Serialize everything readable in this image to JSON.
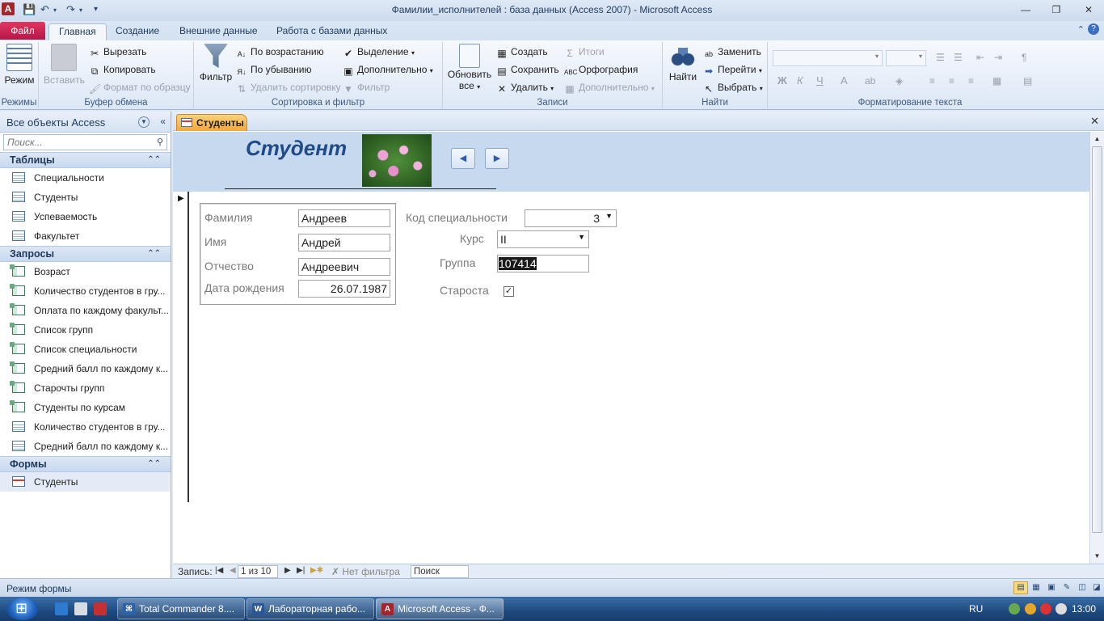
{
  "window": {
    "title": "Фамилии_исполнителей : база данных (Access 2007)  -  Microsoft Access",
    "app_icon": "A"
  },
  "ribbon_tabs": [
    {
      "label": "Файл"
    },
    {
      "label": "Главная"
    },
    {
      "label": "Создание"
    },
    {
      "label": "Внешние данные"
    },
    {
      "label": "Работа с базами данных"
    }
  ],
  "ribbon": {
    "views": {
      "label": "Режим",
      "group": "Режимы"
    },
    "clipboard": {
      "paste": "Вставить",
      "cut": "Вырезать",
      "copy": "Копировать",
      "format_painter": "Формат по образцу",
      "group": "Буфер обмена"
    },
    "sort_filter": {
      "filter": "Фильтр",
      "ascending": "По возрастанию",
      "descending": "По убыванию",
      "remove_sort": "Удалить сортировку",
      "selection": "Выделение",
      "advanced": "Дополнительно",
      "toggle_filter": "Фильтр",
      "group": "Сортировка и фильтр"
    },
    "records": {
      "refresh": "Обновить",
      "refresh2": "все",
      "new": "Создать",
      "save": "Сохранить",
      "delete": "Удалить",
      "totals": "Итоги",
      "spelling": "Орфография",
      "more": "Дополнительно",
      "group": "Записи"
    },
    "find": {
      "find": "Найти",
      "replace": "Заменить",
      "goto": "Перейти",
      "select": "Выбрать",
      "group": "Найти"
    },
    "text_format": {
      "bold": "Ж",
      "italic": "К",
      "underline": "Ч",
      "group": "Форматирование текста"
    }
  },
  "nav_pane": {
    "header": "Все объекты Access",
    "search_placeholder": "Поиск...",
    "groups": [
      {
        "title": "Таблицы",
        "items": [
          "Специальности",
          "Студенты",
          "Успеваемость",
          "Факультет"
        ]
      },
      {
        "title": "Запросы",
        "items": [
          "Возраст",
          "Количество студентов в гру...",
          "Оплата по каждому факульт...",
          "Список групп",
          "Список специальности",
          "Средний балл по каждому к...",
          "Старочты групп",
          "Студенты по курсам",
          "Количество студентов в гру...",
          "Средний балл по каждому к..."
        ]
      },
      {
        "title": "Формы",
        "items": [
          "Студенты"
        ]
      }
    ]
  },
  "document_tab": {
    "label": "Студенты"
  },
  "form": {
    "title": "Студент",
    "fields": {
      "last_name": {
        "label": "Фамилия",
        "value": "Андреев"
      },
      "first_name": {
        "label": "Имя",
        "value": "Андрей"
      },
      "middle_name": {
        "label": "Отчество",
        "value": "Андреевич"
      },
      "birth_date": {
        "label": "Дата рождения",
        "value": "26.07.1987"
      },
      "specialty_code": {
        "label": "Код специальности",
        "value": "3"
      },
      "course": {
        "label": "Курс",
        "value": "II"
      },
      "group": {
        "label": "Группа",
        "value": "107414"
      },
      "head": {
        "label": "Староста",
        "checked": true
      }
    }
  },
  "record_nav": {
    "label": "Запись:",
    "position": "1 из 10",
    "filter": "Нет фильтра",
    "search": "Поиск"
  },
  "statusbar": {
    "text": "Режим формы"
  },
  "taskbar": {
    "items": [
      {
        "label": "Total Commander 8...."
      },
      {
        "label": "Лабораторная рабо..."
      },
      {
        "label": "Microsoft Access - Ф..."
      }
    ],
    "lang": "RU",
    "clock": "13:00"
  },
  "colors": {
    "file_tab": "#c41e57",
    "form_header_bg": "#c6d9ef",
    "form_title": "#1f4b8a",
    "doc_tab": "#f3a63c"
  }
}
